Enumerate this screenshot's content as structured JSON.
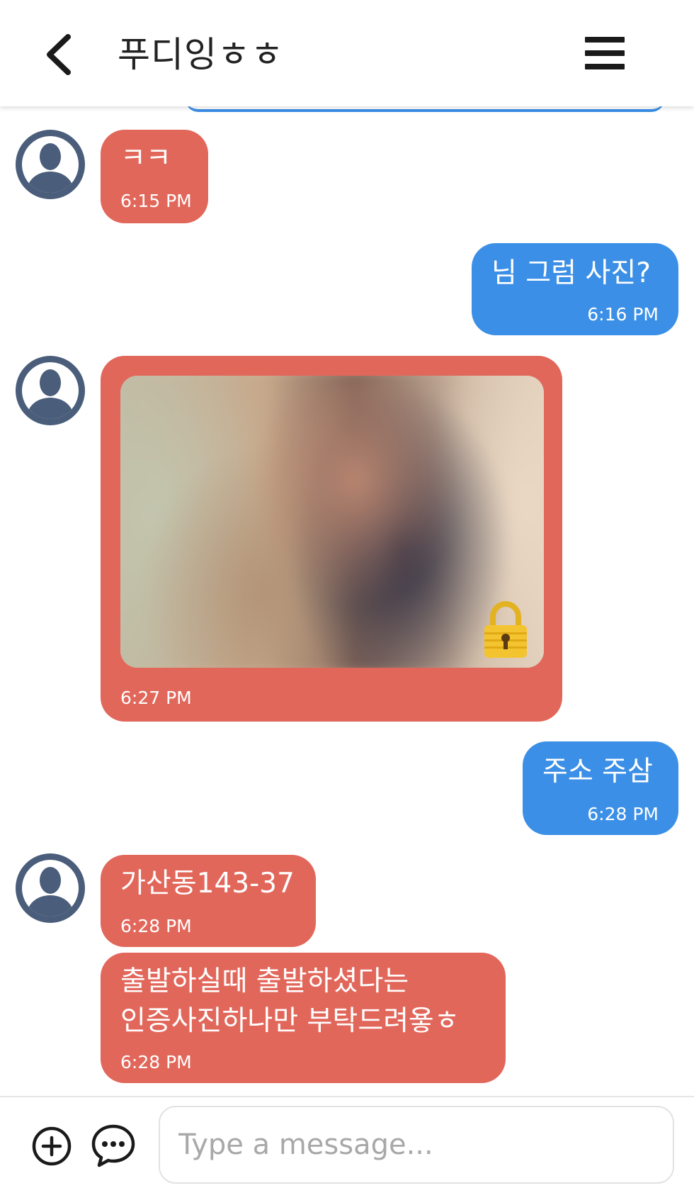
{
  "header": {
    "title": "푸디잉ㅎㅎ",
    "back_icon": "chevron-left-icon",
    "menu_icon": "hamburger-menu-icon"
  },
  "messages": [
    {
      "direction": "incoming",
      "text": "ㅋㅋ",
      "time": "6:15 PM"
    },
    {
      "direction": "outgoing",
      "text": "님 그럼 사진?",
      "time": "6:16 PM"
    },
    {
      "direction": "incoming",
      "type": "locked-photo",
      "time": "6:27 PM",
      "icon": "lock-icon"
    },
    {
      "direction": "outgoing",
      "text": "주소 주삼",
      "time": "6:28 PM"
    },
    {
      "direction": "incoming",
      "text": "가산동143-37",
      "time": "6:28 PM"
    },
    {
      "direction": "incoming",
      "text_lines": [
        "출발하실때 출발하셨다는",
        "인증사진하나만 부탁드려욯ㅎ"
      ],
      "time": "6:28 PM"
    }
  ],
  "composer": {
    "placeholder": "Type a message...",
    "value": "",
    "add_icon": "plus-circle-icon",
    "chat_icon": "chat-bubble-icon"
  },
  "colors": {
    "incoming_bubble": "#e2675b",
    "outgoing_bubble": "#3b8fe6",
    "avatar": "#4a5d7a",
    "lock": "#f4c430"
  }
}
